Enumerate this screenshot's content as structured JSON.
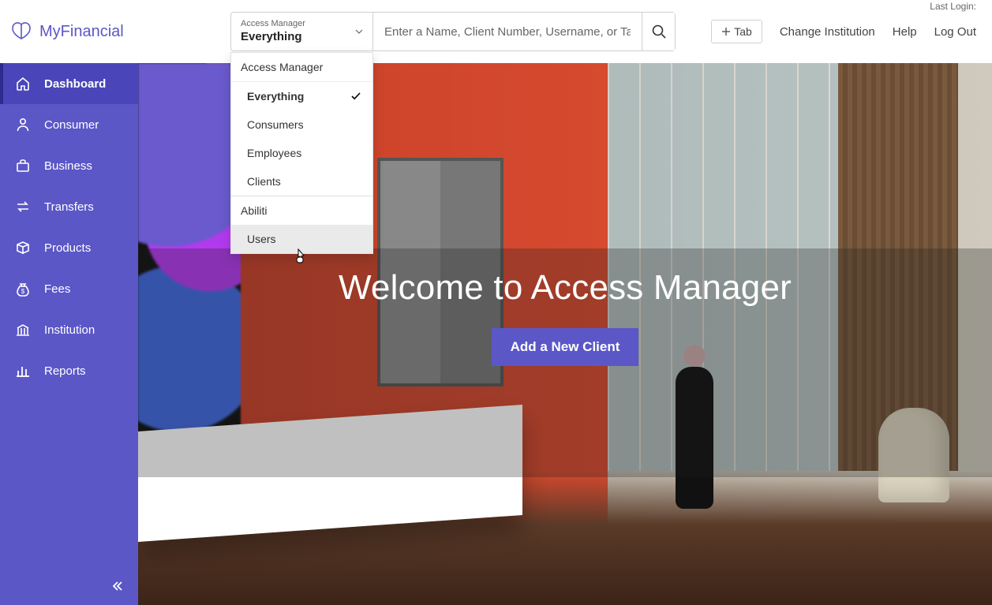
{
  "brand": {
    "name": "MyFinancial"
  },
  "topbar": {
    "last_login_label": "Last Login:",
    "tab_button": "Tab",
    "links": {
      "change_institution": "Change Institution",
      "help": "Help",
      "logout": "Log Out"
    }
  },
  "search": {
    "scope_label": "Access Manager",
    "scope_value": "Everything",
    "placeholder": "Enter a Name, Client Number, Username, or Tax ID"
  },
  "dropdown": {
    "header": "Access Manager",
    "group1": [
      {
        "label": "Everything",
        "selected": true
      },
      {
        "label": "Consumers"
      },
      {
        "label": "Employees"
      },
      {
        "label": "Clients"
      }
    ],
    "section2_header": "Abiliti",
    "group2": [
      {
        "label": "Users",
        "hover": true
      }
    ]
  },
  "sidebar": {
    "items": [
      {
        "label": "Dashboard",
        "icon": "home",
        "active": true
      },
      {
        "label": "Consumer",
        "icon": "person"
      },
      {
        "label": "Business",
        "icon": "briefcase"
      },
      {
        "label": "Transfers",
        "icon": "transfers"
      },
      {
        "label": "Products",
        "icon": "box"
      },
      {
        "label": "Fees",
        "icon": "moneybag"
      },
      {
        "label": "Institution",
        "icon": "institution"
      },
      {
        "label": "Reports",
        "icon": "barchart"
      }
    ]
  },
  "hero": {
    "title": "Welcome to Access Manager",
    "cta": "Add a New Client"
  }
}
